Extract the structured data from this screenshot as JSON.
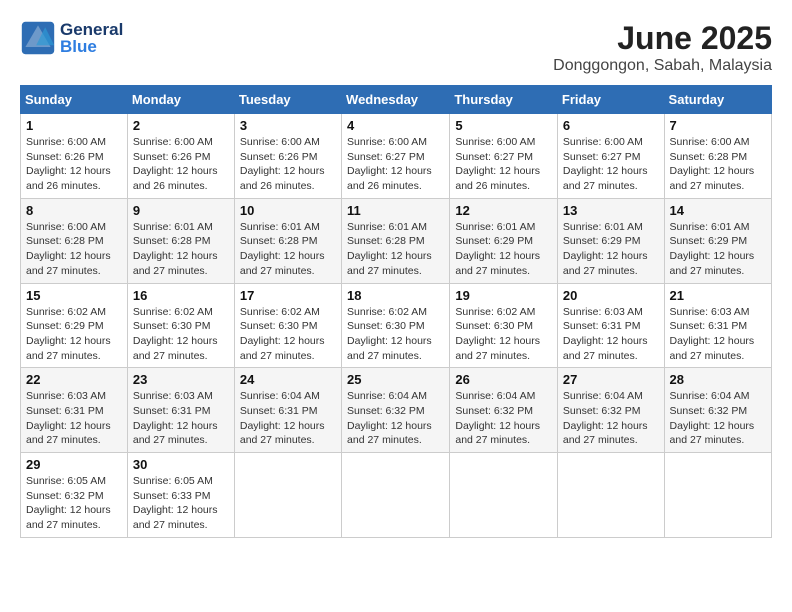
{
  "header": {
    "logo_general": "General",
    "logo_blue": "Blue",
    "month": "June 2025",
    "location": "Donggongon, Sabah, Malaysia"
  },
  "weekdays": [
    "Sunday",
    "Monday",
    "Tuesday",
    "Wednesday",
    "Thursday",
    "Friday",
    "Saturday"
  ],
  "weeks": [
    [
      {
        "day": "1",
        "info": "Sunrise: 6:00 AM\nSunset: 6:26 PM\nDaylight: 12 hours\nand 26 minutes."
      },
      {
        "day": "2",
        "info": "Sunrise: 6:00 AM\nSunset: 6:26 PM\nDaylight: 12 hours\nand 26 minutes."
      },
      {
        "day": "3",
        "info": "Sunrise: 6:00 AM\nSunset: 6:26 PM\nDaylight: 12 hours\nand 26 minutes."
      },
      {
        "day": "4",
        "info": "Sunrise: 6:00 AM\nSunset: 6:27 PM\nDaylight: 12 hours\nand 26 minutes."
      },
      {
        "day": "5",
        "info": "Sunrise: 6:00 AM\nSunset: 6:27 PM\nDaylight: 12 hours\nand 26 minutes."
      },
      {
        "day": "6",
        "info": "Sunrise: 6:00 AM\nSunset: 6:27 PM\nDaylight: 12 hours\nand 27 minutes."
      },
      {
        "day": "7",
        "info": "Sunrise: 6:00 AM\nSunset: 6:28 PM\nDaylight: 12 hours\nand 27 minutes."
      }
    ],
    [
      {
        "day": "8",
        "info": "Sunrise: 6:00 AM\nSunset: 6:28 PM\nDaylight: 12 hours\nand 27 minutes."
      },
      {
        "day": "9",
        "info": "Sunrise: 6:01 AM\nSunset: 6:28 PM\nDaylight: 12 hours\nand 27 minutes."
      },
      {
        "day": "10",
        "info": "Sunrise: 6:01 AM\nSunset: 6:28 PM\nDaylight: 12 hours\nand 27 minutes."
      },
      {
        "day": "11",
        "info": "Sunrise: 6:01 AM\nSunset: 6:28 PM\nDaylight: 12 hours\nand 27 minutes."
      },
      {
        "day": "12",
        "info": "Sunrise: 6:01 AM\nSunset: 6:29 PM\nDaylight: 12 hours\nand 27 minutes."
      },
      {
        "day": "13",
        "info": "Sunrise: 6:01 AM\nSunset: 6:29 PM\nDaylight: 12 hours\nand 27 minutes."
      },
      {
        "day": "14",
        "info": "Sunrise: 6:01 AM\nSunset: 6:29 PM\nDaylight: 12 hours\nand 27 minutes."
      }
    ],
    [
      {
        "day": "15",
        "info": "Sunrise: 6:02 AM\nSunset: 6:29 PM\nDaylight: 12 hours\nand 27 minutes."
      },
      {
        "day": "16",
        "info": "Sunrise: 6:02 AM\nSunset: 6:30 PM\nDaylight: 12 hours\nand 27 minutes."
      },
      {
        "day": "17",
        "info": "Sunrise: 6:02 AM\nSunset: 6:30 PM\nDaylight: 12 hours\nand 27 minutes."
      },
      {
        "day": "18",
        "info": "Sunrise: 6:02 AM\nSunset: 6:30 PM\nDaylight: 12 hours\nand 27 minutes."
      },
      {
        "day": "19",
        "info": "Sunrise: 6:02 AM\nSunset: 6:30 PM\nDaylight: 12 hours\nand 27 minutes."
      },
      {
        "day": "20",
        "info": "Sunrise: 6:03 AM\nSunset: 6:31 PM\nDaylight: 12 hours\nand 27 minutes."
      },
      {
        "day": "21",
        "info": "Sunrise: 6:03 AM\nSunset: 6:31 PM\nDaylight: 12 hours\nand 27 minutes."
      }
    ],
    [
      {
        "day": "22",
        "info": "Sunrise: 6:03 AM\nSunset: 6:31 PM\nDaylight: 12 hours\nand 27 minutes."
      },
      {
        "day": "23",
        "info": "Sunrise: 6:03 AM\nSunset: 6:31 PM\nDaylight: 12 hours\nand 27 minutes."
      },
      {
        "day": "24",
        "info": "Sunrise: 6:04 AM\nSunset: 6:31 PM\nDaylight: 12 hours\nand 27 minutes."
      },
      {
        "day": "25",
        "info": "Sunrise: 6:04 AM\nSunset: 6:32 PM\nDaylight: 12 hours\nand 27 minutes."
      },
      {
        "day": "26",
        "info": "Sunrise: 6:04 AM\nSunset: 6:32 PM\nDaylight: 12 hours\nand 27 minutes."
      },
      {
        "day": "27",
        "info": "Sunrise: 6:04 AM\nSunset: 6:32 PM\nDaylight: 12 hours\nand 27 minutes."
      },
      {
        "day": "28",
        "info": "Sunrise: 6:04 AM\nSunset: 6:32 PM\nDaylight: 12 hours\nand 27 minutes."
      }
    ],
    [
      {
        "day": "29",
        "info": "Sunrise: 6:05 AM\nSunset: 6:32 PM\nDaylight: 12 hours\nand 27 minutes."
      },
      {
        "day": "30",
        "info": "Sunrise: 6:05 AM\nSunset: 6:33 PM\nDaylight: 12 hours\nand 27 minutes."
      },
      null,
      null,
      null,
      null,
      null
    ]
  ]
}
